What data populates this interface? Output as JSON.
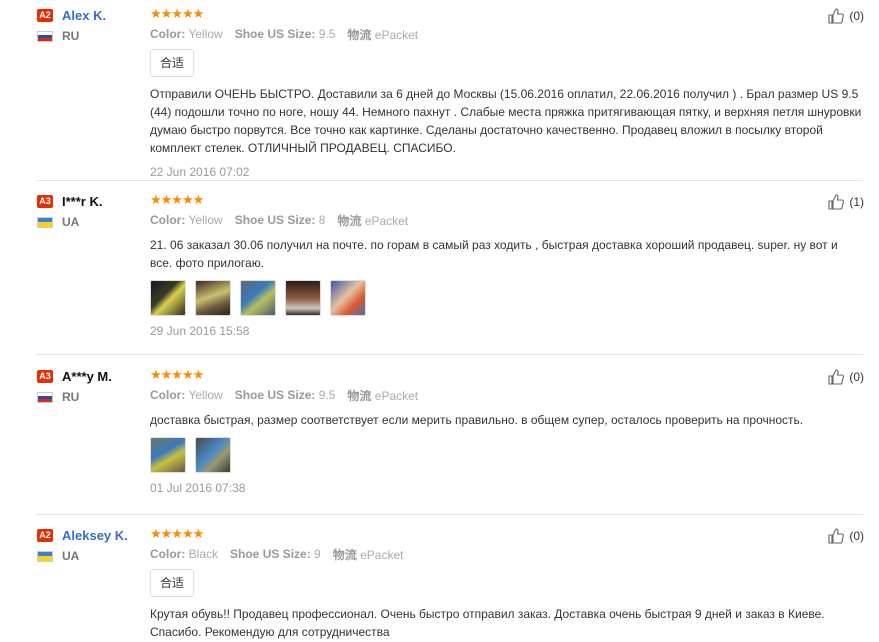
{
  "reviews": [
    {
      "level": "A2",
      "name": "Alex K.",
      "country": "RU",
      "stars": "★★★★★",
      "color_label": "Color:",
      "color_value": "Yellow",
      "size_label": "Shoe US Size:",
      "size_value": "9.5",
      "shipping_label": "物流",
      "shipping_value": "ePacket",
      "tag": "合适",
      "text": "Отправили ОЧЕНЬ БЫСТРО. Доставили за 6 дней до Москвы (15.06.2016 оплатил, 22.06.2016 получил ) . Брал размер US 9.5 (44) подошли точно по ноге, ношу 44. Немного пахнут . Слабые места пряжка притягивающая пятку, и верхняя петля шнуровки думаю быстро порвутся. Все точно как картинке. Сделаны достаточно качественно. Продавец вложил в посылку второй комплект стелек. ОТЛИЧНЫЙ ПРОДАВЕЦ. СПАСИБО.",
      "date": "22 Jun 2016 07:02",
      "likes": "(0)"
    },
    {
      "level": "A3",
      "name": "I***r K.",
      "country": "UA",
      "stars": "★★★★★",
      "color_label": "Color:",
      "color_value": "Yellow",
      "size_label": "Shoe US Size:",
      "size_value": "8",
      "shipping_label": "物流",
      "shipping_value": "ePacket",
      "text": "21. 06 заказал 30.06 получил на почте. по горам в самый раз ходить , быстрая доставка хороший продавец. super. ну вот и все. фото прилогаю.",
      "date": "29 Jun 2016 15:58",
      "likes": "(1)"
    },
    {
      "level": "A3",
      "name": "A***y M.",
      "country": "RU",
      "stars": "★★★★★",
      "color_label": "Color:",
      "color_value": "Yellow",
      "size_label": "Shoe US Size:",
      "size_value": "9.5",
      "shipping_label": "物流",
      "shipping_value": "ePacket",
      "text": "доставка быстрая, размер соответствует если мерить правильно. в общем супер, осталось проверить на прочность.",
      "date": "01 Jul 2016 07:38",
      "likes": "(0)"
    },
    {
      "level": "A2",
      "name": "Aleksey K.",
      "country": "UA",
      "stars": "★★★★★",
      "color_label": "Color:",
      "color_value": "Black",
      "size_label": "Shoe US Size:",
      "size_value": "9",
      "shipping_label": "物流",
      "shipping_value": "ePacket",
      "tag": "合适",
      "text": "Крутая обувь!! Продавец профессионал. Очень быстро отправил заказ. Доставка очень быстрая 9 дней и заказ в Киеве. Спасибо. Рекомендую для сотрудничества",
      "likes": "(0)"
    }
  ],
  "colors": {
    "accent": "#ff8a00",
    "level_badge": "#e62e04",
    "name_blue": "#3a6cc1"
  }
}
